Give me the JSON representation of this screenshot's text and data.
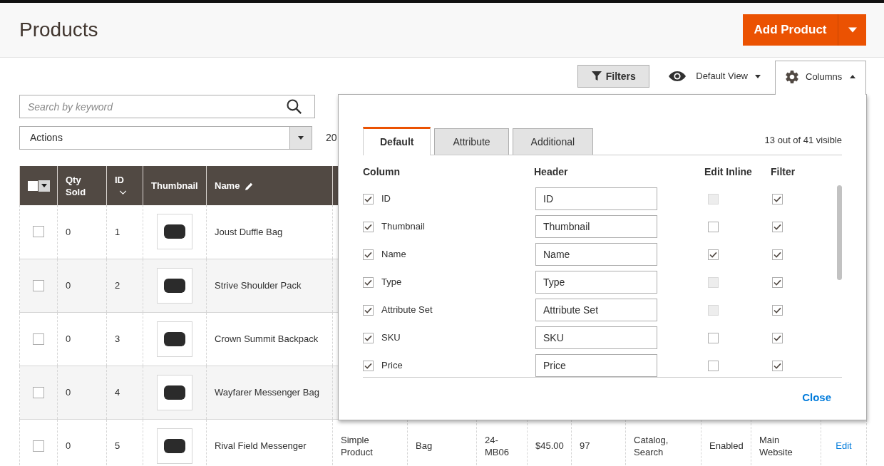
{
  "page_header": {
    "title": "Products",
    "add_button": "Add Product"
  },
  "toolbar": {
    "filters_button": "Filters",
    "view_selector": "Default View",
    "columns_button": {
      "label": "Columns",
      "expanded": true
    }
  },
  "search": {
    "placeholder": "Search by keyword"
  },
  "actions_select": {
    "value": "Actions"
  },
  "records_found": "20",
  "table": {
    "select_all": {
      "checked": false
    },
    "columns": [
      {
        "label": "Qty Sold",
        "sorted": false,
        "editable": false
      },
      {
        "label": "ID",
        "sorted": true,
        "editable": false
      },
      {
        "label": "Thumbnail",
        "sorted": false,
        "editable": false
      },
      {
        "label": "Name",
        "sorted": false,
        "editable": true
      }
    ],
    "rows": [
      {
        "selected": false,
        "cells": [
          {
            "kind": "text",
            "text": "0"
          },
          {
            "kind": "text",
            "text": "1"
          },
          {
            "kind": "image"
          },
          {
            "kind": "text",
            "text": "Joust Duffle Bag"
          }
        ]
      },
      {
        "selected": false,
        "cells": [
          {
            "kind": "text",
            "text": "0"
          },
          {
            "kind": "text",
            "text": "2"
          },
          {
            "kind": "image"
          },
          {
            "kind": "text",
            "text": "Strive Shoulder Pack"
          }
        ]
      },
      {
        "selected": false,
        "cells": [
          {
            "kind": "text",
            "text": "0"
          },
          {
            "kind": "text",
            "text": "3"
          },
          {
            "kind": "image"
          },
          {
            "kind": "text",
            "text": "Crown Summit Backpack"
          }
        ]
      },
      {
        "selected": false,
        "cells": [
          {
            "kind": "text",
            "text": "0"
          },
          {
            "kind": "text",
            "text": "4"
          },
          {
            "kind": "image"
          },
          {
            "kind": "text",
            "text": "Wayfarer Messenger Bag"
          }
        ]
      },
      {
        "selected": false,
        "cells": [
          {
            "kind": "text",
            "text": "0"
          },
          {
            "kind": "text",
            "text": "5"
          },
          {
            "kind": "image"
          },
          {
            "kind": "text",
            "text": "Rival Field Messenger"
          },
          {
            "kind": "text",
            "text": "Simple Product"
          },
          {
            "kind": "text",
            "text": "Bag"
          },
          {
            "kind": "text",
            "text": "24-MB06"
          },
          {
            "kind": "text",
            "text": "$45.00"
          },
          {
            "kind": "text",
            "text": "97"
          },
          {
            "kind": "text",
            "text": "Catalog, Search"
          },
          {
            "kind": "text",
            "text": "Enabled"
          },
          {
            "kind": "text",
            "text": "Main Website"
          },
          {
            "kind": "link",
            "text": "Edit"
          }
        ]
      }
    ]
  },
  "columns_panel": {
    "tabs": [
      {
        "label": "Default",
        "selected": true
      },
      {
        "label": "Attribute",
        "selected": false
      },
      {
        "label": "Additional",
        "selected": false
      }
    ],
    "summary": "13 out of 41 visible",
    "headings": [
      "Column",
      "Header",
      "Edit Inline",
      "Filter"
    ],
    "rows": [
      {
        "label": "ID",
        "visible": true,
        "header": "ID",
        "edit_inline": false,
        "edit_inline_disabled": true,
        "filter": true
      },
      {
        "label": "Thumbnail",
        "visible": true,
        "header": "Thumbnail",
        "edit_inline": false,
        "edit_inline_disabled": false,
        "filter": true
      },
      {
        "label": "Name",
        "visible": true,
        "header": "Name",
        "edit_inline": true,
        "edit_inline_disabled": false,
        "filter": true
      },
      {
        "label": "Type",
        "visible": true,
        "header": "Type",
        "edit_inline": false,
        "edit_inline_disabled": true,
        "filter": true
      },
      {
        "label": "Attribute Set",
        "visible": true,
        "header": "Attribute Set",
        "edit_inline": false,
        "edit_inline_disabled": true,
        "filter": true
      },
      {
        "label": "SKU",
        "visible": true,
        "header": "SKU",
        "edit_inline": false,
        "edit_inline_disabled": false,
        "filter": true
      },
      {
        "label": "Price",
        "visible": true,
        "header": "Price",
        "edit_inline": false,
        "edit_inline_disabled": false,
        "filter": true
      }
    ],
    "close_link": "Close"
  }
}
